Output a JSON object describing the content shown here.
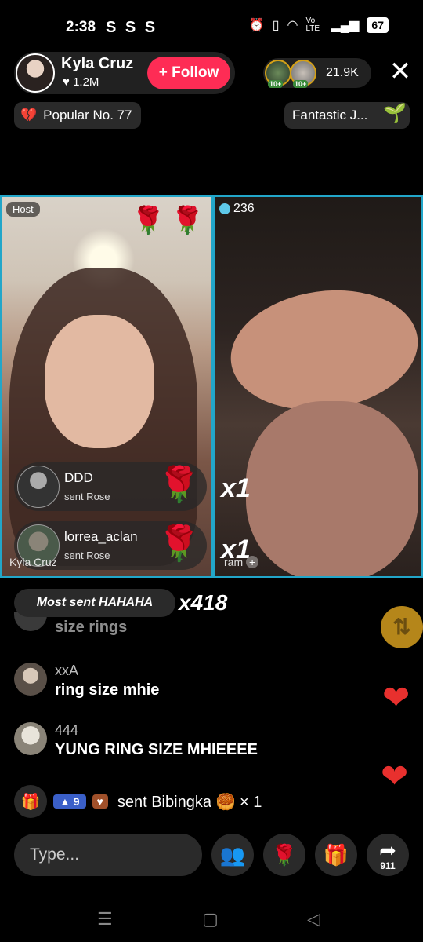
{
  "status_bar": {
    "time": "2:38",
    "app_icons": "S S S",
    "battery": "67",
    "network": "Vo LTE"
  },
  "header": {
    "host_name": "Kyla Cruz",
    "host_likes": "♥ 1.2M",
    "follow_label": "+ Follow",
    "viewer_badge_1": "10+",
    "viewer_badge_2": "10+",
    "viewer_count": "21.9K",
    "close_icon": "close-icon"
  },
  "tags": {
    "popular_label": "Popular No. 77",
    "fantastic_label": "Fantastic J..."
  },
  "host_panel": {
    "host_tag": "Host",
    "name": "Kyla Cruz",
    "gift_cards": [
      {
        "user": "DDD",
        "action": "sent Rose"
      },
      {
        "user": "lorrea_aclan",
        "action": "sent Rose"
      }
    ]
  },
  "guest_panel": {
    "count": "236",
    "multiplier_1": "x1",
    "multiplier_2": "x1",
    "name": "ram"
  },
  "chat": {
    "most_sent_label": "Most sent HAHAHA",
    "most_sent_count": "x418",
    "faded_message": "size rings",
    "messages": [
      {
        "user": "xxA",
        "text": "ring size mhie"
      },
      {
        "user": "444",
        "text": "YUNG RING SIZE MHIEEEE"
      }
    ],
    "gift_event": {
      "level": "9",
      "text": "sent Bibingka 🥮 × 1"
    }
  },
  "bottom_bar": {
    "input_placeholder": "Type...",
    "share_count": "911"
  },
  "colors": {
    "follow": "#fe2c55",
    "panel_border": "#22a6c9",
    "heart": "#e8302e"
  }
}
